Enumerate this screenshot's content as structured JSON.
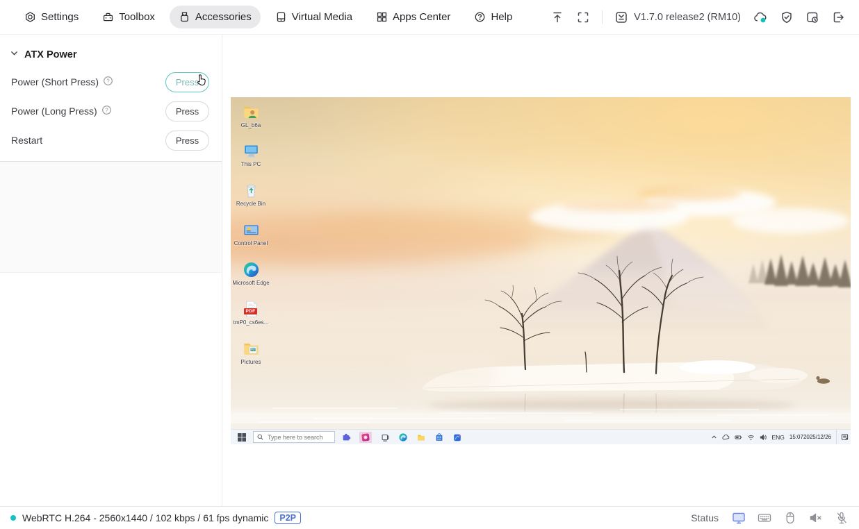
{
  "topnav": {
    "items": [
      {
        "label": "Settings"
      },
      {
        "label": "Toolbox"
      },
      {
        "label": "Accessories"
      },
      {
        "label": "Virtual Media"
      },
      {
        "label": "Apps Center"
      },
      {
        "label": "Help"
      }
    ],
    "version": "V1.7.0 release2 (RM10)"
  },
  "panel": {
    "section_title": "ATX Power",
    "rows": [
      {
        "label": "Power (Short Press)",
        "button": "Press"
      },
      {
        "label": "Power (Long Press)",
        "button": "Press"
      },
      {
        "label": "Restart",
        "button": "Press"
      }
    ]
  },
  "remote": {
    "desktop_icons": [
      {
        "label": "GL_b6a"
      },
      {
        "label": "This PC"
      },
      {
        "label": "Recycle Bin"
      },
      {
        "label": "Control Panel"
      },
      {
        "label": "Microsoft Edge"
      },
      {
        "label": "tmP0_cs6es...",
        "badge": "PDF"
      },
      {
        "label": "Pictures"
      }
    ],
    "taskbar": {
      "search_placeholder": "Type here to search",
      "language": "ENG",
      "time": "15:07",
      "date": "2025/12/26"
    }
  },
  "statusbar": {
    "connection": "WebRTC H.264 - 2560x1440 / 102 kbps / 61 fps dynamic",
    "badge": "P2P",
    "status_label": "Status"
  },
  "colors": {
    "accent_teal": "#13c2c2",
    "p2p_blue": "#4a6fd3"
  }
}
